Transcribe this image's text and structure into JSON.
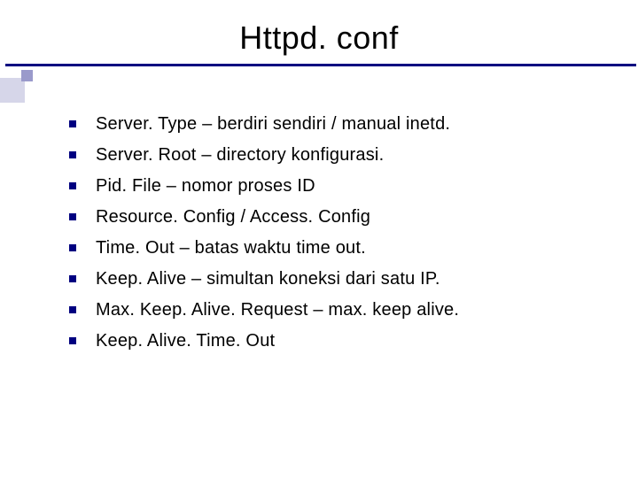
{
  "title": "Httpd. conf",
  "bullets": [
    "Server. Type – berdiri sendiri / manual inetd.",
    "Server. Root – directory konfigurasi.",
    "Pid. File – nomor proses ID",
    "Resource. Config / Access. Config",
    "Time. Out – batas waktu time out.",
    "Keep. Alive – simultan koneksi dari satu IP.",
    "Max. Keep. Alive. Request – max. keep alive.",
    "Keep. Alive. Time. Out"
  ]
}
